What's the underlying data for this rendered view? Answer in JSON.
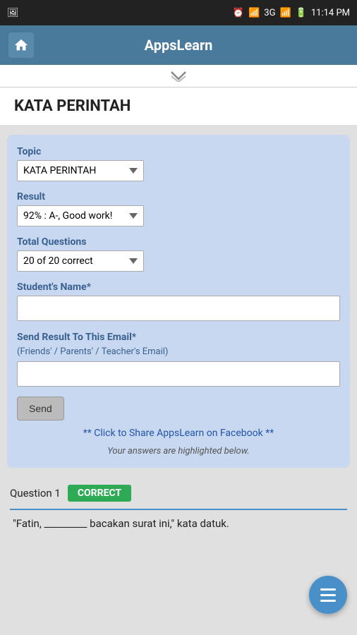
{
  "statusBar": {
    "time": "11:14 PM",
    "network": "3G"
  },
  "titleBar": {
    "title": "AppsLearn"
  },
  "chevron": "❯❯",
  "sectionHeader": {
    "title": "KATA PERINTAH"
  },
  "form": {
    "topicLabel": "Topic",
    "topicValue": "KATA PERINTAH",
    "resultLabel": "Result",
    "resultValue": "92% : A-, Good work!",
    "totalQuestionsLabel": "Total Questions",
    "totalQuestionsValue": "20 of 20 correct",
    "studentNameLabel": "Student's Name*",
    "studentNamePlaceholder": "",
    "emailLabel": "Send Result To This Email*",
    "emailSubLabel": "(Friends' / Parents' / Teacher's Email)",
    "emailPlaceholder": "",
    "sendButtonLabel": "Send",
    "facebookLink": "** Click to Share AppsLearn on Facebook **",
    "answersNote": "Your answers are highlighted below."
  },
  "questions": [
    {
      "number": "Question 1",
      "status": "CORRECT",
      "text": "\"Fatin, _________ bacakan surat ini,\" kata datuk."
    }
  ]
}
